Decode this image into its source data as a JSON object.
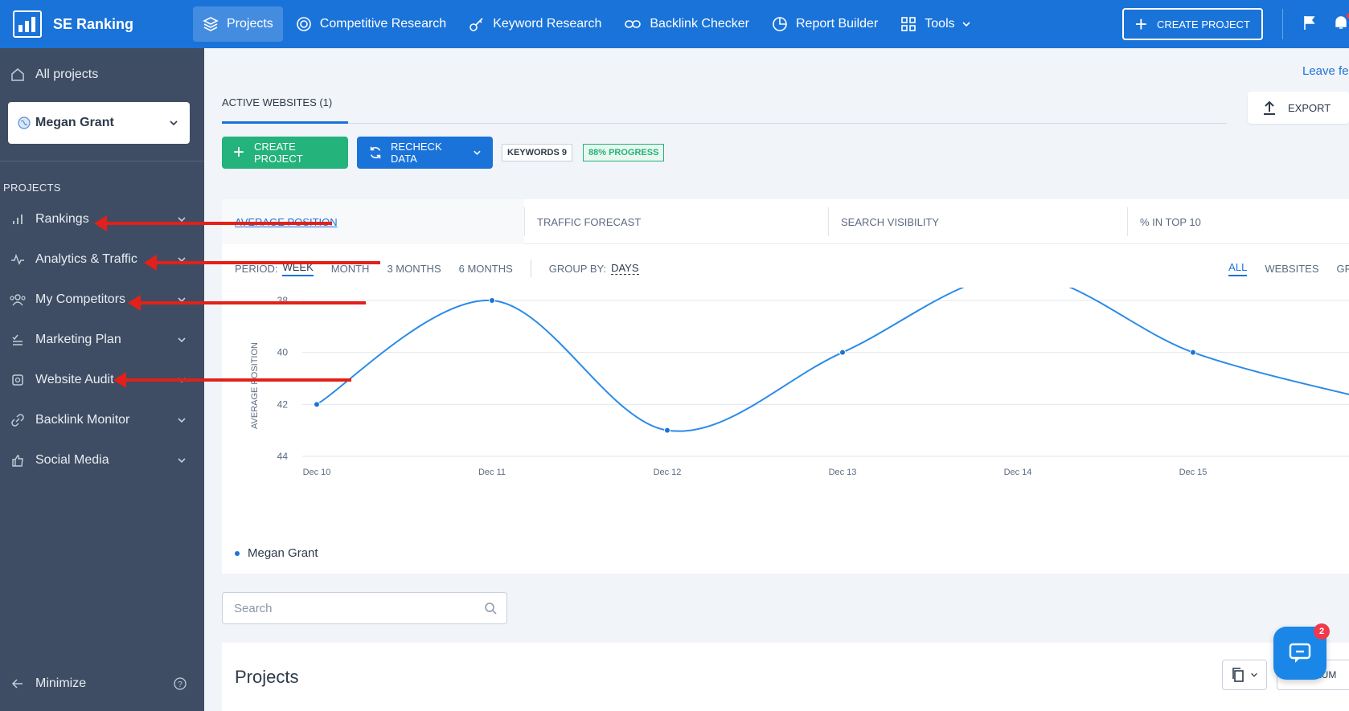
{
  "app": {
    "name": "SE Ranking"
  },
  "topnav": {
    "items": [
      {
        "label": "Projects"
      },
      {
        "label": "Competitive Research"
      },
      {
        "label": "Keyword Research"
      },
      {
        "label": "Backlink Checker"
      },
      {
        "label": "Report Builder"
      },
      {
        "label": "Tools"
      }
    ],
    "create_project": "CREATE PROJECT"
  },
  "sidebar": {
    "all_projects": "All projects",
    "selected_project": "Megan Grant",
    "section_label": "PROJECTS",
    "items": [
      {
        "label": "Rankings"
      },
      {
        "label": "Analytics & Traffic"
      },
      {
        "label": "My Competitors"
      },
      {
        "label": "Marketing Plan"
      },
      {
        "label": "Website Audit"
      },
      {
        "label": "Backlink Monitor"
      },
      {
        "label": "Social Media"
      }
    ],
    "minimize": "Minimize"
  },
  "main": {
    "leave_feedback": "Leave fe",
    "tab_active": "ACTIVE WEBSITES (1)",
    "export": "EXPORT",
    "create_project": "CREATE PROJECT",
    "recheck_data": "RECHECK DATA",
    "keywords_chip": "KEYWORDS 9",
    "progress_chip": "88%  PROGRESS",
    "metric_tabs": [
      "AVERAGE POSITION",
      "TRAFFIC FORECAST",
      "SEARCH VISIBILITY",
      "% IN TOP 10"
    ],
    "period_label": "PERIOD:",
    "periods": [
      "WEEK",
      "MONTH",
      "3 MONTHS",
      "6 MONTHS"
    ],
    "group_by_label": "GROUP BY:",
    "group_by_value": "DAYS",
    "scopes": [
      "ALL",
      "WEBSITES",
      "GR"
    ],
    "search_placeholder": "Search",
    "projects_title": "Projects",
    "columns_btn": "COLUM",
    "chat_badge": "2"
  },
  "colors": {
    "brand": "#1a73d9",
    "sidebar": "#3e4d63",
    "green": "#24b37a",
    "annotation_arrow": "#e32019"
  },
  "chart_data": {
    "type": "line",
    "x": [
      "Dec 10",
      "Dec 11",
      "Dec 12",
      "Dec 13",
      "Dec 14",
      "Dec 15"
    ],
    "series": [
      {
        "name": "Megan Grant",
        "values": [
          42,
          38,
          43,
          40,
          37,
          40,
          41.8
        ]
      }
    ],
    "ylabel": "AVERAGE POSITION",
    "yticks": [
      38,
      40,
      42,
      44
    ],
    "ylim": [
      44,
      37
    ],
    "y_inverted": true,
    "grid": true
  }
}
